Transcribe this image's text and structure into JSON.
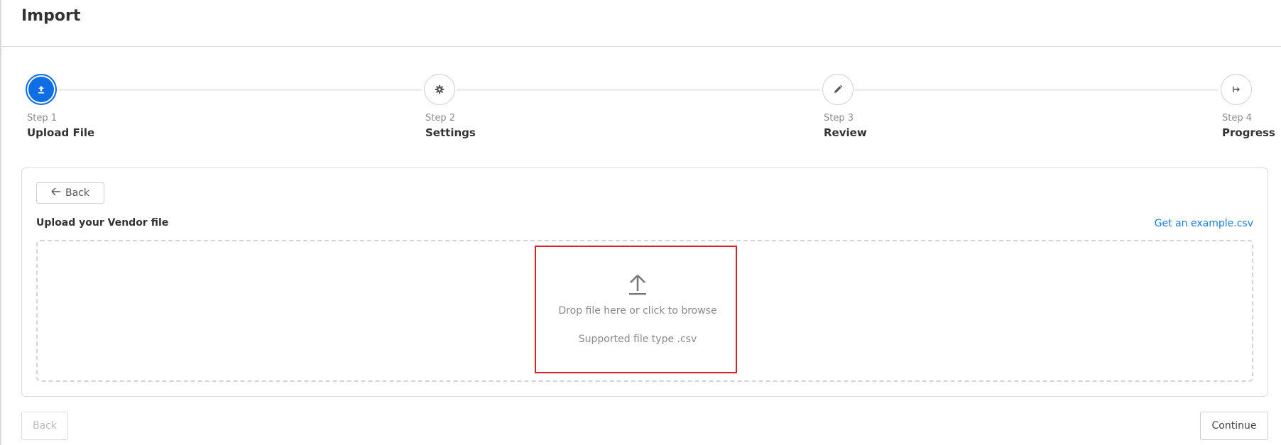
{
  "header": {
    "title": "Import"
  },
  "steps": [
    {
      "label": "Step 1",
      "name": "Upload File",
      "icon": "upload-icon",
      "active": true
    },
    {
      "label": "Step 2",
      "name": "Settings",
      "icon": "gear-icon",
      "active": false
    },
    {
      "label": "Step 3",
      "name": "Review",
      "icon": "pencil-icon",
      "active": false
    },
    {
      "label": "Step 4",
      "name": "Progress",
      "icon": "export-arrow-icon",
      "active": false
    }
  ],
  "card": {
    "back_label": "Back",
    "heading": "Upload your Vendor file",
    "example_link": "Get an example.csv",
    "dropzone": {
      "icon": "upload-arrow-icon",
      "text": "Drop file here or click to browse",
      "subtext": "Supported file type .csv"
    }
  },
  "footer": {
    "back_label": "Back",
    "continue_label": "Continue"
  },
  "colors": {
    "accent": "#0f6ee6",
    "link": "#1a7be0",
    "highlight": "#e02020",
    "border": "#dcdcdc"
  }
}
